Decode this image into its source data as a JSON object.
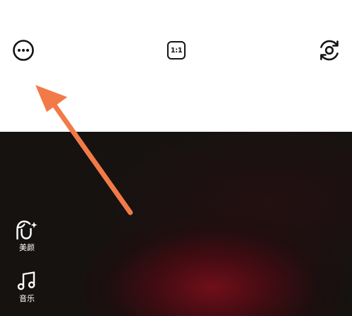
{
  "toolbar": {
    "more_icon": "more-horizontal-icon",
    "aspect_ratio_label": "1:1",
    "flip_camera_icon": "flip-camera-icon"
  },
  "side_tools": {
    "beauty": {
      "label": "美颜",
      "icon": "beauty-face-sparkle-icon"
    },
    "music": {
      "label": "音乐",
      "icon": "music-note-icon"
    }
  },
  "annotation": {
    "icon": "arrow-pointer",
    "color": "#F27A48"
  },
  "colors": {
    "top_bar": "#FFFFFF",
    "viewfinder": "#151210",
    "glow": "#760E1A",
    "icon_dark": "#141414"
  }
}
